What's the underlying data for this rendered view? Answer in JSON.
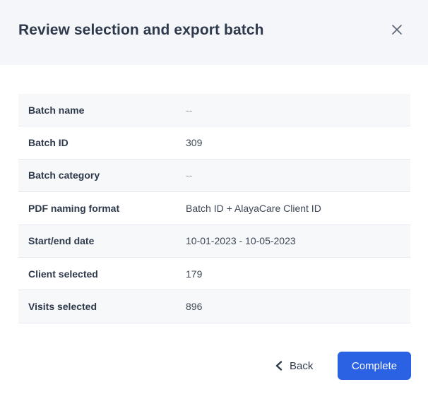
{
  "dialog": {
    "title": "Review selection and export batch",
    "close_icon": "close-icon"
  },
  "summary": {
    "rows": [
      {
        "label": "Batch name",
        "value": "--"
      },
      {
        "label": "Batch ID",
        "value": "309"
      },
      {
        "label": "Batch category",
        "value": "--"
      },
      {
        "label": "PDF naming format",
        "value": "Batch ID + AlayaCare Client ID"
      },
      {
        "label": "Start/end date",
        "value": "10-01-2023 - 10-05-2023"
      },
      {
        "label": "Client selected",
        "value": "179"
      },
      {
        "label": "Visits selected",
        "value": "896"
      }
    ]
  },
  "footer": {
    "back_label": "Back",
    "back_icon": "chevron-left-icon",
    "complete_label": "Complete"
  },
  "colors": {
    "header_background": "#f4f6f9",
    "primary_button": "#2b62e3",
    "row_shade": "#f7f8fa"
  }
}
